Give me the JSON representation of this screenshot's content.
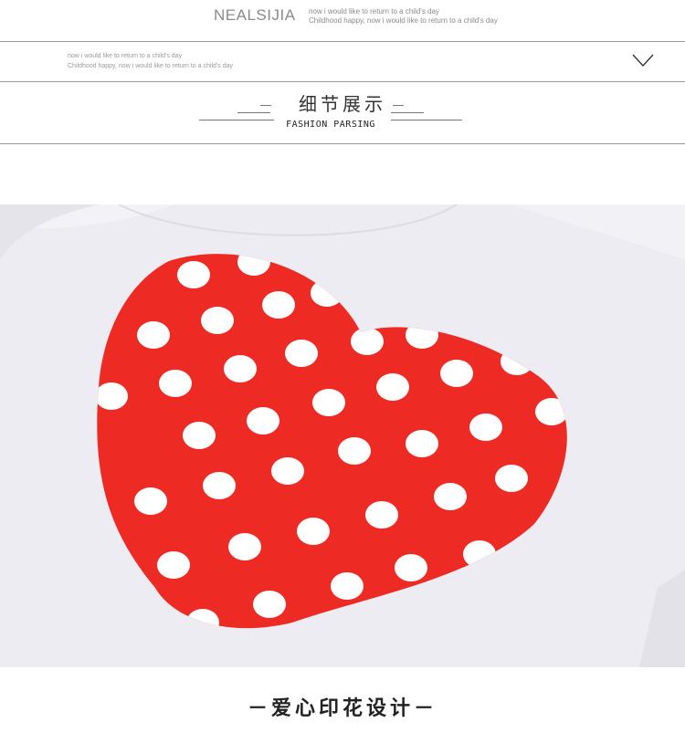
{
  "header": {
    "brand": "NEALSIJIA",
    "tagline_line1": "now i would like to return to a child's day",
    "tagline_line2": "Childhood happy, now i would like to return to a child's day"
  },
  "subheader": {
    "line1": "now i would like to return to a child's day",
    "line2": "Childhood happy, now i would like to return to a child's day",
    "toggle_icon": "chevron-down-icon"
  },
  "section": {
    "title_cn": "细节展示",
    "title_en": "FASHION PARSING"
  },
  "product_image": {
    "print_color": "#ee2a24",
    "fabric_color": "#ececf2",
    "dot_color": "#ffffff"
  },
  "caption": "－爱心印花设计－"
}
